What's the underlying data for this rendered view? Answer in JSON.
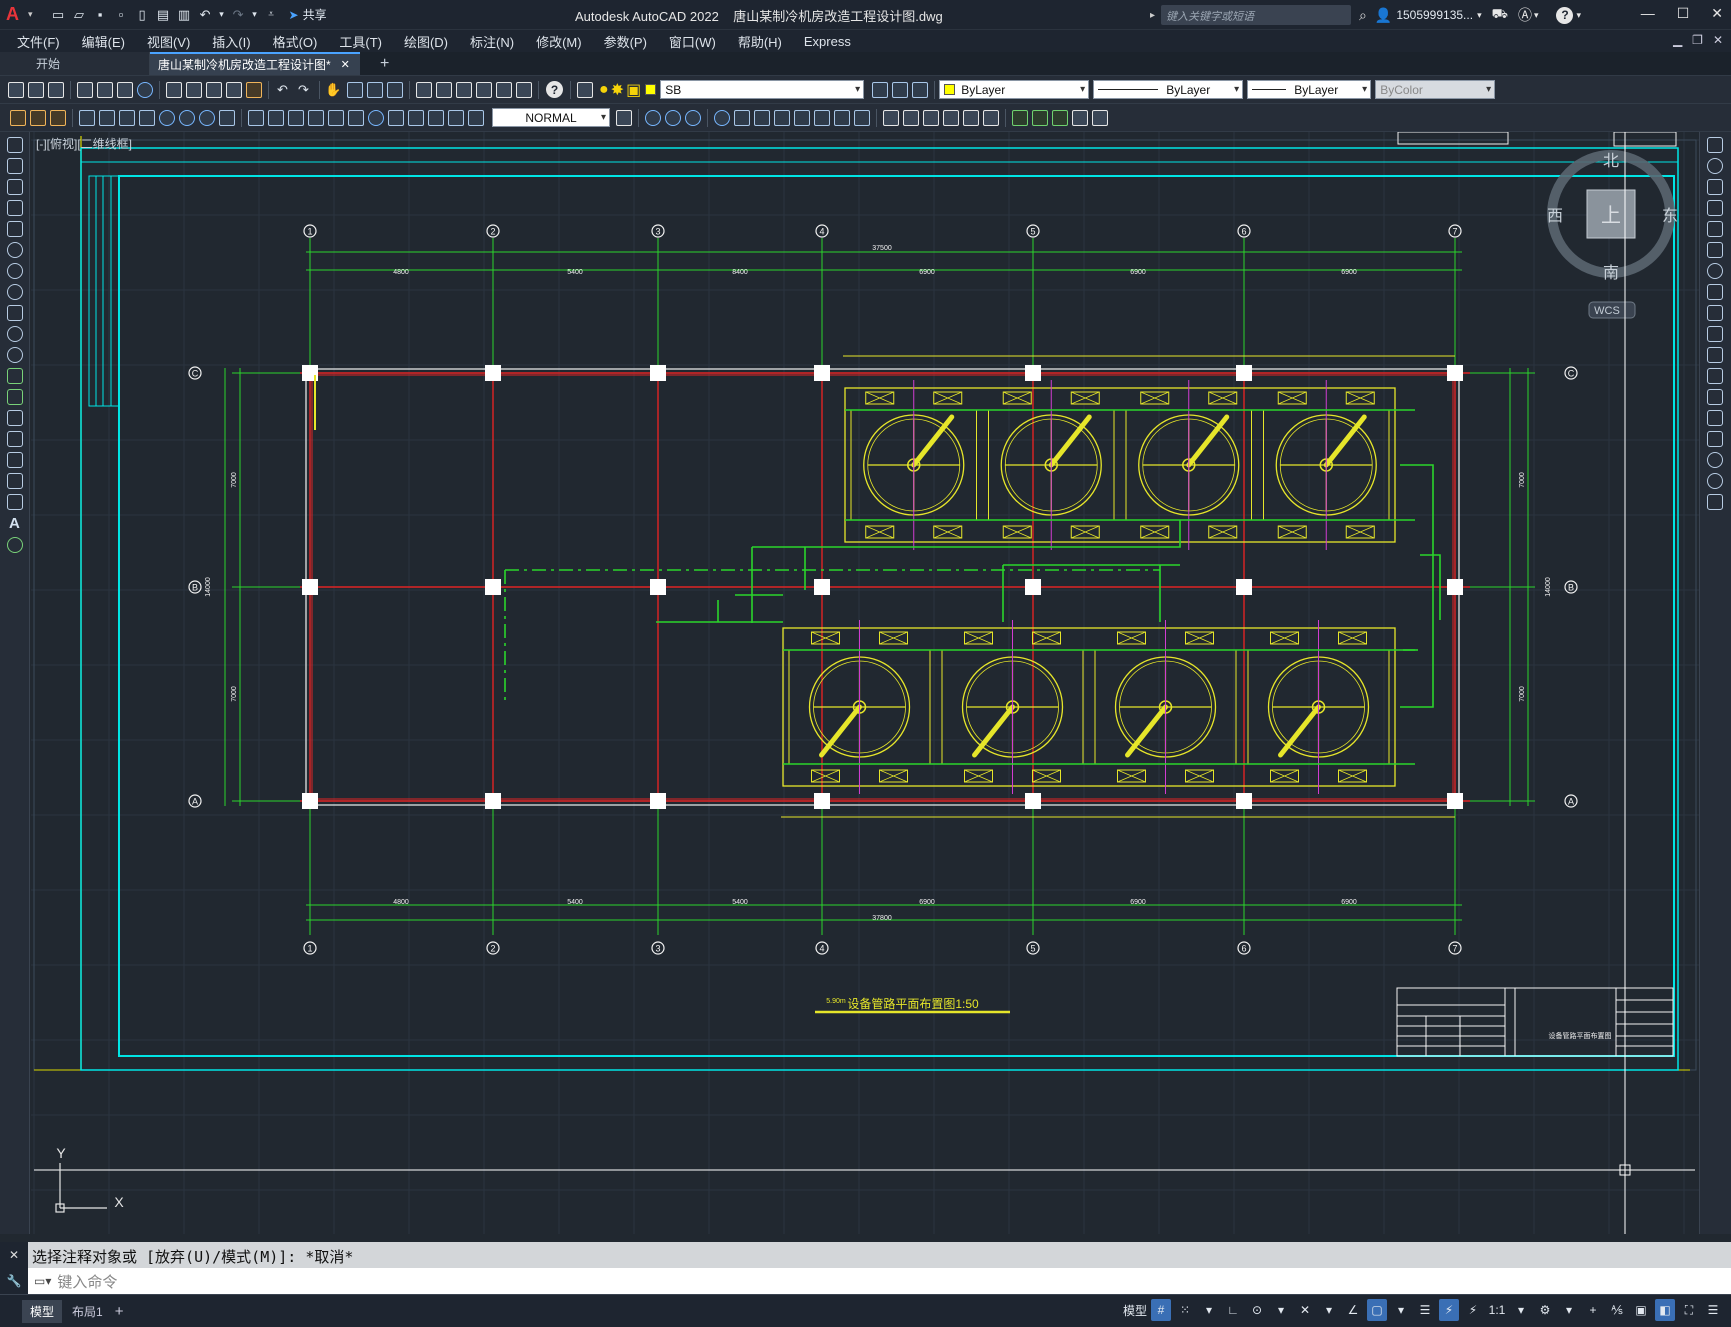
{
  "window": {
    "app_title": "Autodesk AutoCAD 2022",
    "file_title": "唐山某制冷机房改造工程设计图.dwg",
    "search_placeholder": "键入关键字或短语",
    "user": "1505999135...",
    "share_label": "共享"
  },
  "menu": [
    "文件(F)",
    "编辑(E)",
    "视图(V)",
    "插入(I)",
    "格式(O)",
    "工具(T)",
    "绘图(D)",
    "标注(N)",
    "修改(M)",
    "参数(P)",
    "窗口(W)",
    "帮助(H)",
    "Express"
  ],
  "tabs": {
    "start": "开始",
    "active": "唐山某制冷机房改造工程设计图*"
  },
  "toolbar": {
    "layer": "SB",
    "color": "ByLayer",
    "linetype": "ByLayer",
    "lineweight": "ByLayer",
    "plotstyle": "ByColor",
    "dimstyle": "NORMAL"
  },
  "viewport": {
    "label": "[-][俯视][二维线框]",
    "compass": {
      "n": "北",
      "s": "南",
      "e": "东",
      "w": "西",
      "top": "上"
    },
    "wcs": "WCS"
  },
  "drawing": {
    "grid_cols": [
      "1",
      "2",
      "3",
      "4",
      "5",
      "6",
      "7"
    ],
    "grid_rows": [
      "C",
      "B",
      "A"
    ],
    "total_dim": "37500",
    "top_dims": [
      "4800",
      "5400",
      "8400",
      "6900",
      "6900",
      "6900"
    ],
    "bottom_dims": [
      "4800",
      "5400",
      "5400",
      "6900",
      "6900",
      "6900"
    ],
    "bottom_total": "37800",
    "side_dims": [
      "7000",
      "7000"
    ],
    "side_total": "14000",
    "title": "设备管路平面布置图1:50",
    "title_level": "5.90m",
    "titleblock_label": "设备管路平面布置图"
  },
  "command": {
    "history": "选择注释对象或 [放弃(U)/模式(M)]: *取消*",
    "placeholder": "键入命令"
  },
  "status": {
    "layout_tabs": [
      "模型",
      "布局1"
    ],
    "model_label": "模型",
    "scale": "1:1"
  }
}
